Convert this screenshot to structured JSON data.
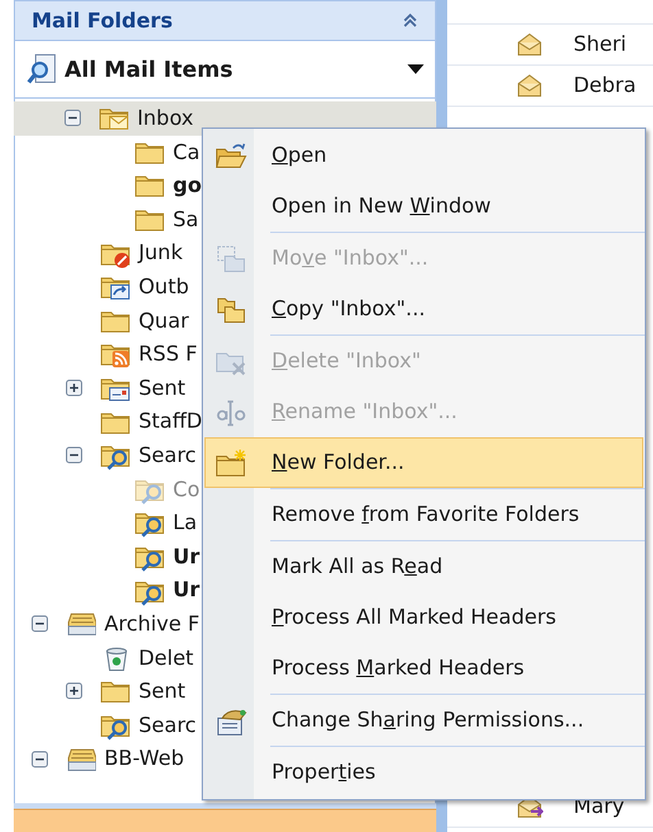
{
  "mail_folders_pane": {
    "title": "Mail Folders",
    "view_dropdown": {
      "value": "All Mail Items"
    }
  },
  "tree": {
    "items_under_scrolled_parent": [
      {
        "label": "Inbox",
        "kind": "inbox",
        "selected": true,
        "bold": false,
        "dimmed": false,
        "expanded": true,
        "children": [
          {
            "label": "Ca",
            "kind": "folder",
            "selected": false,
            "bold": false,
            "dimmed": false
          },
          {
            "label": "go",
            "kind": "folder",
            "selected": false,
            "bold": true,
            "dimmed": false
          },
          {
            "label": "Sa",
            "kind": "folder",
            "selected": false,
            "bold": false,
            "dimmed": false
          }
        ]
      },
      {
        "label": "Junk",
        "kind": "junk",
        "selected": false,
        "bold": false,
        "dimmed": false
      },
      {
        "label": "Outb",
        "kind": "outbox",
        "selected": false,
        "bold": false,
        "dimmed": false
      },
      {
        "label": "Quar",
        "kind": "folder",
        "selected": false,
        "bold": false,
        "dimmed": false
      },
      {
        "label": "RSS F",
        "kind": "rss",
        "selected": false,
        "bold": false,
        "dimmed": false
      },
      {
        "label": "Sent",
        "kind": "sent",
        "selected": false,
        "bold": false,
        "dimmed": false,
        "expanded": false
      },
      {
        "label": "StaffD",
        "kind": "folder",
        "selected": false,
        "bold": false,
        "dimmed": false
      },
      {
        "label": "Searc",
        "kind": "search",
        "selected": false,
        "bold": false,
        "dimmed": false,
        "expanded": true,
        "children": [
          {
            "label": "Co",
            "kind": "search",
            "selected": false,
            "bold": false,
            "dimmed": true
          },
          {
            "label": "La",
            "kind": "search",
            "selected": false,
            "bold": false,
            "dimmed": false
          },
          {
            "label": "Ur",
            "kind": "search",
            "selected": false,
            "bold": true,
            "dimmed": false
          },
          {
            "label": "Ur",
            "kind": "search",
            "selected": false,
            "bold": true,
            "dimmed": false
          }
        ]
      }
    ],
    "items": [
      {
        "label": "Archive F",
        "kind": "archive",
        "selected": false,
        "bold": false,
        "dimmed": false,
        "expanded": true,
        "children": [
          {
            "label": "Delet",
            "kind": "deleted",
            "selected": false,
            "bold": false,
            "dimmed": false
          },
          {
            "label": "Sent",
            "kind": "folder",
            "selected": false,
            "bold": false,
            "dimmed": false,
            "expanded": false
          },
          {
            "label": "Searc",
            "kind": "search",
            "selected": false,
            "bold": false,
            "dimmed": false
          }
        ]
      },
      {
        "label": "BB-Web",
        "kind": "archive",
        "selected": false,
        "bold": false,
        "dimmed": false,
        "expanded": true
      }
    ]
  },
  "message_list": [
    {
      "sender": "Sheri",
      "kind": "read"
    },
    {
      "sender": "Debra",
      "kind": "read"
    },
    {
      "sender": "Mary",
      "kind": "forwarded"
    }
  ],
  "context_menu": [
    {
      "kind": "item",
      "accelerator": "O",
      "text_after": "pen",
      "disabled": false,
      "selected": false
    },
    {
      "kind": "item",
      "text_before": "Open in New ",
      "accelerator": "W",
      "text_after": "indow",
      "disabled": false,
      "selected": false
    },
    {
      "kind": "separator"
    },
    {
      "kind": "item",
      "text_before": "Mo",
      "accelerator": "v",
      "text_after": "e \"Inbox\"...",
      "disabled": true,
      "selected": false
    },
    {
      "kind": "item",
      "accelerator": "C",
      "text_after": "opy \"Inbox\"...",
      "disabled": false,
      "selected": false
    },
    {
      "kind": "separator"
    },
    {
      "kind": "item",
      "accelerator": "D",
      "text_after": "elete \"Inbox\"",
      "disabled": true,
      "selected": false
    },
    {
      "kind": "item",
      "accelerator": "R",
      "text_after": "ename \"Inbox\"...",
      "disabled": true,
      "selected": false
    },
    {
      "kind": "item",
      "accelerator": "N",
      "text_after": "ew Folder...",
      "disabled": false,
      "selected": true
    },
    {
      "kind": "separator"
    },
    {
      "kind": "item",
      "text_before": "Remove ",
      "accelerator": "f",
      "text_after": "rom Favorite Folders",
      "disabled": false,
      "selected": false
    },
    {
      "kind": "separator"
    },
    {
      "kind": "item",
      "text_before": "Mark All as R",
      "accelerator": "e",
      "text_after": "ad",
      "disabled": false,
      "selected": false
    },
    {
      "kind": "item",
      "accelerator": "P",
      "text_after": "rocess All Marked Headers",
      "disabled": false,
      "selected": false
    },
    {
      "kind": "item",
      "text_before": "Process ",
      "accelerator": "M",
      "text_after": "arked Headers",
      "disabled": false,
      "selected": false
    },
    {
      "kind": "separator"
    },
    {
      "kind": "item",
      "text_before": "Change Sh",
      "accelerator": "a",
      "text_after": "ring Permissions...",
      "disabled": false,
      "selected": false
    },
    {
      "kind": "separator"
    },
    {
      "kind": "item",
      "text_before": "Proper",
      "accelerator": "t",
      "text_after": "ies",
      "disabled": false,
      "selected": false
    }
  ]
}
